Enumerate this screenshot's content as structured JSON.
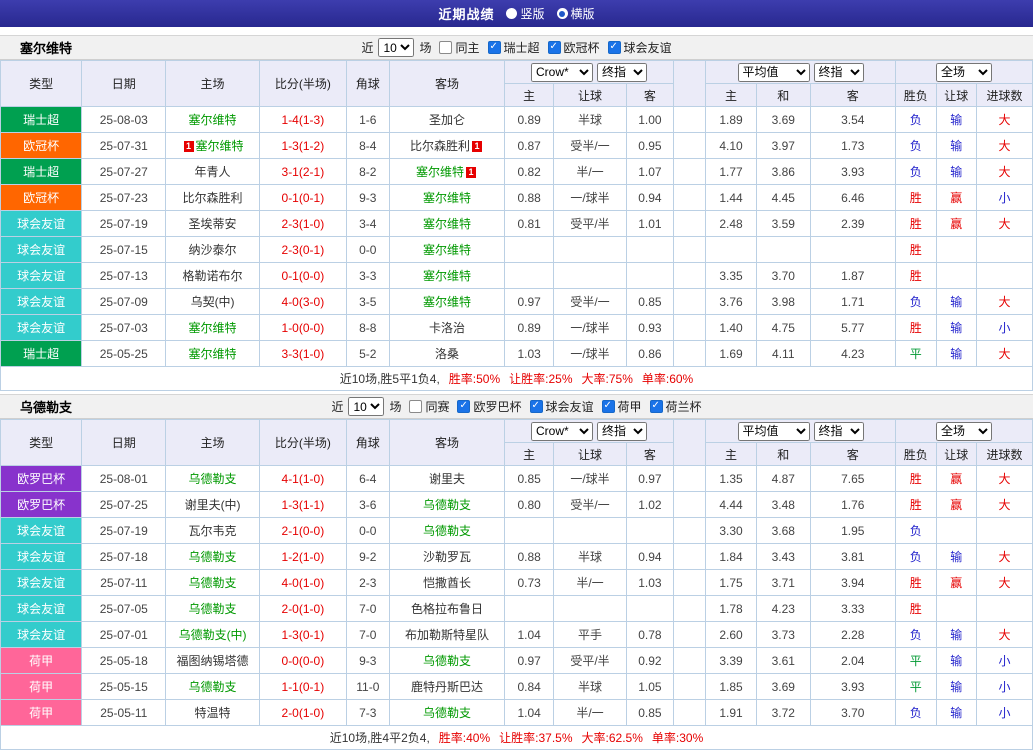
{
  "topbar": {
    "title": "近期战绩",
    "modes": [
      {
        "label": "竖版",
        "selected": false
      },
      {
        "label": "横版",
        "selected": true
      }
    ]
  },
  "colors": {
    "league": {
      "瑞士超": "#00a050",
      "欧冠杯": "#ff6600",
      "球会友谊": "#33cccc",
      "欧罗巴杯": "#8833cc",
      "荷甲": "#ff6699"
    },
    "self_team": "#009900",
    "score": "#e60000",
    "result": {
      "胜": "#e60000",
      "平": "#009933",
      "负": "#2222cc",
      "赢": "#e60000",
      "输": "#2222cc",
      "大": "#e60000",
      "小": "#2222cc"
    }
  },
  "table_header": {
    "static_cols": [
      "类型",
      "日期",
      "主场",
      "比分(半场)",
      "角球",
      "客场"
    ],
    "group1_selects": [
      "Crow*",
      "终指"
    ],
    "group2_selects": [
      "平均值",
      "终指"
    ],
    "group3_select": "全场",
    "sub_cols": [
      "主",
      "让球",
      "客",
      "主",
      "和",
      "客",
      "胜负",
      "让球",
      "进球数"
    ]
  },
  "sections": [
    {
      "team": "塞尔维特",
      "filter": {
        "prefix": "近",
        "count": "10",
        "suffix": "场",
        "same_label": "同主",
        "same_checked": false,
        "leagues": [
          "瑞士超",
          "欧冠杯",
          "球会友谊"
        ]
      },
      "rows": [
        {
          "league": "瑞士超",
          "date": "25-08-03",
          "home": "塞尔维特",
          "home_self": true,
          "home_card": "",
          "score": "1-4(1-3)",
          "corner": "1-6",
          "away": "圣加仑",
          "away_self": false,
          "away_card": "",
          "crown": [
            "0.89",
            "半球",
            "1.00"
          ],
          "avg": [
            "1.89",
            "3.69",
            "3.54"
          ],
          "result": [
            "负",
            "输",
            "大"
          ]
        },
        {
          "league": "欧冠杯",
          "date": "25-07-31",
          "home": "塞尔维特",
          "home_self": true,
          "home_card": "1",
          "score": "1-3(1-2)",
          "corner": "8-4",
          "away": "比尔森胜利",
          "away_self": false,
          "away_card": "1",
          "crown": [
            "0.87",
            "受半/一",
            "0.95"
          ],
          "avg": [
            "4.10",
            "3.97",
            "1.73"
          ],
          "result": [
            "负",
            "输",
            "大"
          ]
        },
        {
          "league": "瑞士超",
          "date": "25-07-27",
          "home": "年青人",
          "home_self": false,
          "home_card": "",
          "score": "3-1(2-1)",
          "corner": "8-2",
          "away": "塞尔维特",
          "away_self": true,
          "away_card": "1",
          "crown": [
            "0.82",
            "半/一",
            "1.07"
          ],
          "avg": [
            "1.77",
            "3.86",
            "3.93"
          ],
          "result": [
            "负",
            "输",
            "大"
          ]
        },
        {
          "league": "欧冠杯",
          "date": "25-07-23",
          "home": "比尔森胜利",
          "home_self": false,
          "home_card": "",
          "score": "0-1(0-1)",
          "corner": "9-3",
          "away": "塞尔维特",
          "away_self": true,
          "away_card": "",
          "crown": [
            "0.88",
            "一/球半",
            "0.94"
          ],
          "avg": [
            "1.44",
            "4.45",
            "6.46"
          ],
          "result": [
            "胜",
            "赢",
            "小"
          ]
        },
        {
          "league": "球会友谊",
          "date": "25-07-19",
          "home": "圣埃蒂安",
          "home_self": false,
          "home_card": "",
          "score": "2-3(1-0)",
          "corner": "3-4",
          "away": "塞尔维特",
          "away_self": true,
          "away_card": "",
          "crown": [
            "0.81",
            "受平/半",
            "1.01"
          ],
          "avg": [
            "2.48",
            "3.59",
            "2.39"
          ],
          "result": [
            "胜",
            "赢",
            "大"
          ]
        },
        {
          "league": "球会友谊",
          "date": "25-07-15",
          "home": "纳沙泰尔",
          "home_self": false,
          "home_card": "",
          "score": "2-3(0-1)",
          "corner": "0-0",
          "away": "塞尔维特",
          "away_self": true,
          "away_card": "",
          "crown": [
            "",
            "",
            ""
          ],
          "avg": [
            "",
            "",
            ""
          ],
          "result": [
            "胜",
            "",
            ""
          ]
        },
        {
          "league": "球会友谊",
          "date": "25-07-13",
          "home": "格勒诺布尔",
          "home_self": false,
          "home_card": "",
          "score": "0-1(0-0)",
          "corner": "3-3",
          "away": "塞尔维特",
          "away_self": true,
          "away_card": "",
          "crown": [
            "",
            "",
            ""
          ],
          "avg": [
            "3.35",
            "3.70",
            "1.87"
          ],
          "result": [
            "胜",
            "",
            ""
          ]
        },
        {
          "league": "球会友谊",
          "date": "25-07-09",
          "home": "乌契(中)",
          "home_self": false,
          "home_card": "",
          "score": "4-0(3-0)",
          "corner": "3-5",
          "away": "塞尔维特",
          "away_self": true,
          "away_card": "",
          "crown": [
            "0.97",
            "受半/一",
            "0.85"
          ],
          "avg": [
            "3.76",
            "3.98",
            "1.71"
          ],
          "result": [
            "负",
            "输",
            "大"
          ]
        },
        {
          "league": "球会友谊",
          "date": "25-07-03",
          "home": "塞尔维特",
          "home_self": true,
          "home_card": "",
          "score": "1-0(0-0)",
          "corner": "8-8",
          "away": "卡洛治",
          "away_self": false,
          "away_card": "",
          "crown": [
            "0.89",
            "一/球半",
            "0.93"
          ],
          "avg": [
            "1.40",
            "4.75",
            "5.77"
          ],
          "result": [
            "胜",
            "输",
            "小"
          ]
        },
        {
          "league": "瑞士超",
          "date": "25-05-25",
          "home": "塞尔维特",
          "home_self": true,
          "home_card": "",
          "score": "3-3(1-0)",
          "corner": "5-2",
          "away": "洛桑",
          "away_self": false,
          "away_card": "",
          "crown": [
            "1.03",
            "一/球半",
            "0.86"
          ],
          "avg": [
            "1.69",
            "4.11",
            "4.23"
          ],
          "result": [
            "平",
            "输",
            "大"
          ]
        }
      ],
      "summary": {
        "record": "近10场,胜5平1负4,",
        "stats": [
          "胜率:50%",
          "让胜率:25%",
          "大率:75%",
          "单率:60%"
        ]
      }
    },
    {
      "team": "乌德勒支",
      "filter": {
        "prefix": "近",
        "count": "10",
        "suffix": "场",
        "same_label": "同赛",
        "same_checked": false,
        "leagues": [
          "欧罗巴杯",
          "球会友谊",
          "荷甲",
          "荷兰杯"
        ]
      },
      "rows": [
        {
          "league": "欧罗巴杯",
          "date": "25-08-01",
          "home": "乌德勒支",
          "home_self": true,
          "home_card": "",
          "score": "4-1(1-0)",
          "corner": "6-4",
          "away": "谢里夫",
          "away_self": false,
          "away_card": "",
          "crown": [
            "0.85",
            "一/球半",
            "0.97"
          ],
          "avg": [
            "1.35",
            "4.87",
            "7.65"
          ],
          "result": [
            "胜",
            "赢",
            "大"
          ]
        },
        {
          "league": "欧罗巴杯",
          "date": "25-07-25",
          "home": "谢里夫(中)",
          "home_self": false,
          "home_card": "",
          "score": "1-3(1-1)",
          "corner": "3-6",
          "away": "乌德勒支",
          "away_self": true,
          "away_card": "",
          "crown": [
            "0.80",
            "受半/一",
            "1.02"
          ],
          "avg": [
            "4.44",
            "3.48",
            "1.76"
          ],
          "result": [
            "胜",
            "赢",
            "大"
          ]
        },
        {
          "league": "球会友谊",
          "date": "25-07-19",
          "home": "瓦尔韦克",
          "home_self": false,
          "home_card": "",
          "score": "2-1(0-0)",
          "corner": "0-0",
          "away": "乌德勒支",
          "away_self": true,
          "away_card": "",
          "crown": [
            "",
            "",
            ""
          ],
          "avg": [
            "3.30",
            "3.68",
            "1.95"
          ],
          "result": [
            "负",
            "",
            ""
          ]
        },
        {
          "league": "球会友谊",
          "date": "25-07-18",
          "home": "乌德勒支",
          "home_self": true,
          "home_card": "",
          "score": "1-2(1-0)",
          "corner": "9-2",
          "away": "沙勒罗瓦",
          "away_self": false,
          "away_card": "",
          "crown": [
            "0.88",
            "半球",
            "0.94"
          ],
          "avg": [
            "1.84",
            "3.43",
            "3.81"
          ],
          "result": [
            "负",
            "输",
            "大"
          ]
        },
        {
          "league": "球会友谊",
          "date": "25-07-11",
          "home": "乌德勒支",
          "home_self": true,
          "home_card": "",
          "score": "4-0(1-0)",
          "corner": "2-3",
          "away": "恺撒酋长",
          "away_self": false,
          "away_card": "",
          "crown": [
            "0.73",
            "半/一",
            "1.03"
          ],
          "avg": [
            "1.75",
            "3.71",
            "3.94"
          ],
          "result": [
            "胜",
            "赢",
            "大"
          ]
        },
        {
          "league": "球会友谊",
          "date": "25-07-05",
          "home": "乌德勒支",
          "home_self": true,
          "home_card": "",
          "score": "2-0(1-0)",
          "corner": "7-0",
          "away": "色格拉布鲁日",
          "away_self": false,
          "away_card": "",
          "crown": [
            "",
            "",
            ""
          ],
          "avg": [
            "1.78",
            "4.23",
            "3.33"
          ],
          "result": [
            "胜",
            "",
            ""
          ]
        },
        {
          "league": "球会友谊",
          "date": "25-07-01",
          "home": "乌德勒支(中)",
          "home_self": true,
          "home_card": "",
          "score": "1-3(0-1)",
          "corner": "7-0",
          "away": "布加勒斯特星队",
          "away_self": false,
          "away_card": "",
          "crown": [
            "1.04",
            "平手",
            "0.78"
          ],
          "avg": [
            "2.60",
            "3.73",
            "2.28"
          ],
          "result": [
            "负",
            "输",
            "大"
          ]
        },
        {
          "league": "荷甲",
          "date": "25-05-18",
          "home": "福图纳锡塔德",
          "home_self": false,
          "home_card": "",
          "score": "0-0(0-0)",
          "corner": "9-3",
          "away": "乌德勒支",
          "away_self": true,
          "away_card": "",
          "crown": [
            "0.97",
            "受平/半",
            "0.92"
          ],
          "avg": [
            "3.39",
            "3.61",
            "2.04"
          ],
          "result": [
            "平",
            "输",
            "小"
          ]
        },
        {
          "league": "荷甲",
          "date": "25-05-15",
          "home": "乌德勒支",
          "home_self": true,
          "home_card": "",
          "score": "1-1(0-1)",
          "corner": "11-0",
          "away": "鹿特丹斯巴达",
          "away_self": false,
          "away_card": "",
          "crown": [
            "0.84",
            "半球",
            "1.05"
          ],
          "avg": [
            "1.85",
            "3.69",
            "3.93"
          ],
          "result": [
            "平",
            "输",
            "小"
          ]
        },
        {
          "league": "荷甲",
          "date": "25-05-11",
          "home": "特温特",
          "home_self": false,
          "home_card": "",
          "score": "2-0(1-0)",
          "corner": "7-3",
          "away": "乌德勒支",
          "away_self": true,
          "away_card": "",
          "crown": [
            "1.04",
            "半/一",
            "0.85"
          ],
          "avg": [
            "1.91",
            "3.72",
            "3.70"
          ],
          "result": [
            "负",
            "输",
            "小"
          ]
        }
      ],
      "summary": {
        "record": "近10场,胜4平2负4,",
        "stats": [
          "胜率:40%",
          "让胜率:37.5%",
          "大率:62.5%",
          "单率:30%"
        ]
      }
    }
  ]
}
